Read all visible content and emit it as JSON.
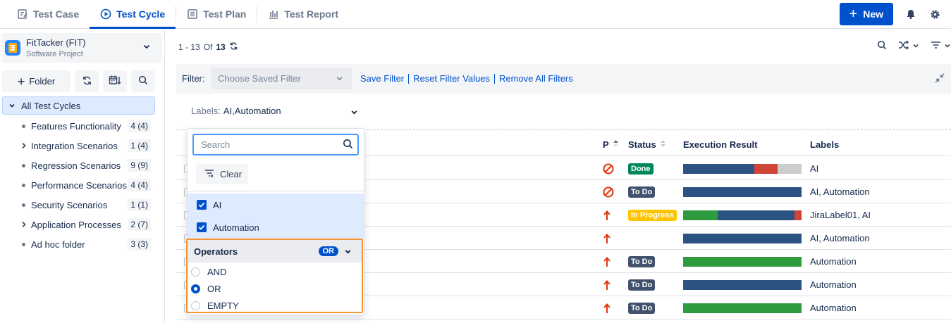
{
  "nav": {
    "tabs": [
      {
        "label": "Test Case",
        "icon": "edit-doc-icon",
        "active": false
      },
      {
        "label": "Test Cycle",
        "icon": "play-circle-icon",
        "active": true
      },
      {
        "label": "Test Plan",
        "icon": "list-doc-icon",
        "active": false
      },
      {
        "label": "Test Report",
        "icon": "bar-chart-icon",
        "active": false
      }
    ],
    "new_label": "New"
  },
  "project": {
    "name": "FitTacker (FIT)",
    "type": "Software Project"
  },
  "sidebar": {
    "folder_label": "Folder",
    "all_label": "All Test Cycles",
    "items": [
      {
        "name": "Features Functionality",
        "count": "4 (4)",
        "marker": "dot"
      },
      {
        "name": "Integration Scenarios",
        "count": "1 (4)",
        "marker": "chevron"
      },
      {
        "name": "Regression Scenarios",
        "count": "9 (9)",
        "marker": "dot"
      },
      {
        "name": "Performance Scenarios",
        "count": "4 (4)",
        "marker": "dot"
      },
      {
        "name": "Security Scenarios",
        "count": "1 (1)",
        "marker": "dot"
      },
      {
        "name": "Application Processes",
        "count": "2 (7)",
        "marker": "chevron"
      },
      {
        "name": "Ad hoc folder",
        "count": "3 (3)",
        "marker": "dot"
      }
    ]
  },
  "pager": {
    "range": "1 - 13",
    "of": "Of",
    "total": "13"
  },
  "filter": {
    "label": "Filter:",
    "saved_placeholder": "Choose Saved Filter",
    "links": [
      "Save Filter",
      "Reset Filter Values",
      "Remove All Filters"
    ],
    "labels_key": "Labels:",
    "labels_value": "AI,Automation"
  },
  "table": {
    "headers": {
      "priority": "P",
      "status": "Status",
      "result": "Execution Result",
      "labels": "Labels"
    },
    "rows": [
      {
        "priority": "blocked",
        "status": "Done",
        "status_color": "#00875a",
        "bar": [
          {
            "f": 0.6,
            "c": "#2c5282"
          },
          {
            "f": 0.2,
            "c": "#d04437"
          },
          {
            "f": 0.2,
            "c": "#cccccc"
          }
        ],
        "labels": "AI"
      },
      {
        "priority": "blocked",
        "status": "To Do",
        "status_color": "#42526e",
        "bar": [
          {
            "f": 1.0,
            "c": "#2c5282"
          }
        ],
        "labels": "AI, Automation"
      },
      {
        "priority": "up",
        "status": "In Progress",
        "status_color": "#ffc400",
        "bar": [
          {
            "f": 0.29,
            "c": "#2e9b3f"
          },
          {
            "f": 0.65,
            "c": "#2c5282"
          },
          {
            "f": 0.06,
            "c": "#d04437"
          }
        ],
        "labels": "JiraLabel01, AI"
      },
      {
        "priority": "up",
        "status": "",
        "status_color": "",
        "bar": [
          {
            "f": 1.0,
            "c": "#2c5282"
          }
        ],
        "labels": "AI, Automation"
      },
      {
        "priority": "up",
        "status": "To Do",
        "status_color": "#42526e",
        "bar": [
          {
            "f": 1.0,
            "c": "#2e9b3f"
          }
        ],
        "labels": "Automation"
      },
      {
        "priority": "up",
        "status": "To Do",
        "status_color": "#42526e",
        "bar": [
          {
            "f": 1.0,
            "c": "#2c5282"
          }
        ],
        "labels": "Automation"
      },
      {
        "priority": "up",
        "status": "To Do",
        "status_color": "#42526e",
        "bar": [
          {
            "f": 1.0,
            "c": "#2e9b3f"
          }
        ],
        "labels": "Automation"
      }
    ]
  },
  "dropdown": {
    "search_placeholder": "Search",
    "clear_label": "Clear",
    "options": [
      "AI",
      "Automation"
    ],
    "operators_title": "Operators",
    "operator_selected": "OR",
    "operators": [
      "AND",
      "OR",
      "EMPTY"
    ]
  },
  "colors": {
    "accent": "#0052cc",
    "highlight": "#f79232",
    "blocked": "#de350b"
  }
}
